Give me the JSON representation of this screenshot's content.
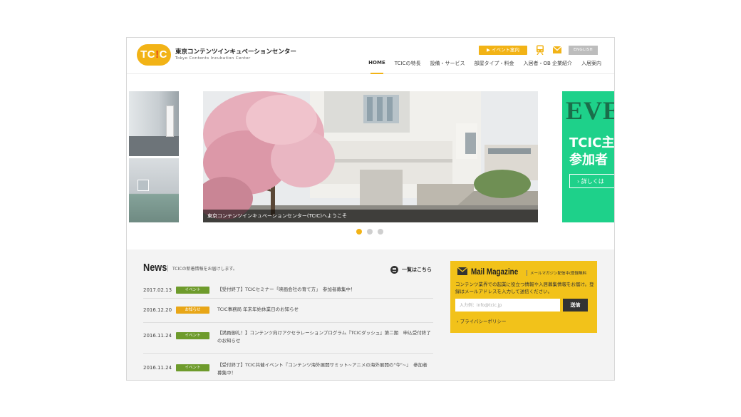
{
  "header": {
    "logo_badge": "TC!C",
    "logo_name_jp": "東京コンテンツインキュベーションセンター",
    "logo_name_en": "Tokyo Contents Incubation Center",
    "event_button": "▶ イベント案内",
    "english_button": "ENGLISH",
    "accent_color": "#f2b316",
    "nav": [
      {
        "label": "HOME",
        "active": true
      },
      {
        "label": "TCICの特長"
      },
      {
        "label": "設備・サービス"
      },
      {
        "label": "部屋タイプ・料金"
      },
      {
        "label": "入居者・OB 企業紹介"
      },
      {
        "label": "入居案内"
      }
    ]
  },
  "slider": {
    "caption": "東京コンテンツインキュベーションセンター(TCIC)へようこそ",
    "next_slide": {
      "title_en": "EVE",
      "line1": "TCIC主",
      "line2": "参加者",
      "button": "› 詳しくは"
    },
    "dots": 3,
    "active_dot": 1
  },
  "news": {
    "title": "News",
    "subtitle": "TCICの新着情報をお届けします。",
    "all_link": "一覧はこちら",
    "items": [
      {
        "date": "2017.02.13",
        "badge": "イベント",
        "badge_color": "#6e9b2c",
        "text": "【受付終了】TCICセミナー「映画会社の育て方」　参加者募集中！"
      },
      {
        "date": "2016.12.20",
        "badge": "お知らせ",
        "badge_color": "#e8a617",
        "text": "TCIC事務局 年末年始休業日のお知らせ"
      },
      {
        "date": "2016.11.24",
        "badge": "イベント",
        "badge_color": "#6e9b2c",
        "text": "【満員御礼！】コンテンツ向けアクセラレーションプログラム『TCICダッシュ』第二期　申込受付終了のお知らせ"
      },
      {
        "date": "2016.11.24",
        "badge": "イベント",
        "badge_color": "#6e9b2c",
        "text": "【受付終了】TCIC共催イベント『コンテンツ海外展開サミット~アニメの海外展開の\"今\"~』　参加者募集中！"
      }
    ]
  },
  "mail_magazine": {
    "title": "Mail Magazine",
    "subtitle": "メールマガジン配信中(登録無料",
    "description": "コンテンツ業界での起業に役立つ情報や入居募集情報をお届け。登録はメールアドレスを入力して送信ください。",
    "input_placeholder": "入力例：info@tcic.jp",
    "send_button": "送信",
    "privacy_link": "› プライバシーポリシー"
  }
}
